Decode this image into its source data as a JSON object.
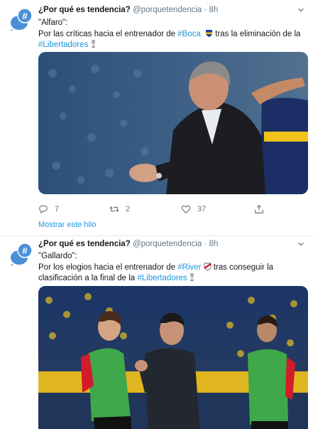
{
  "tweets": [
    {
      "display_name": "¿Por qué es tendencia?",
      "handle": "@porquetendencia",
      "separator": "·",
      "time": "8h",
      "quote": "\"Alfaro\":",
      "line1_pre": "Por las críticas hacia el entrenador de ",
      "hashtag1": "#Boca",
      "line1_post": " tras la eliminación de la",
      "hashtag2": "#Libertadores",
      "team_badge_icon": "boca-crest-icon",
      "actions": {
        "replies": "7",
        "retweets": "2",
        "likes": "37"
      },
      "show_thread": "Mostrar este hilo"
    },
    {
      "display_name": "¿Por qué es tendencia?",
      "handle": "@porquetendencia",
      "separator": "·",
      "time": "8h",
      "quote": "\"Gallardo\":",
      "line1_pre": "Por los elogios hacia el entrenador de ",
      "hashtag1": "#River",
      "line1_post": " tras conseguir la",
      "line2_pre": "clasificación a la final de la ",
      "hashtag2": "#Libertadores",
      "team_badge_icon": "river-crest-icon"
    }
  ],
  "colors": {
    "link": "#1b95e0",
    "secondary": "#657786",
    "divider": "#e6ecf0",
    "avatar": "#4a90d9"
  }
}
